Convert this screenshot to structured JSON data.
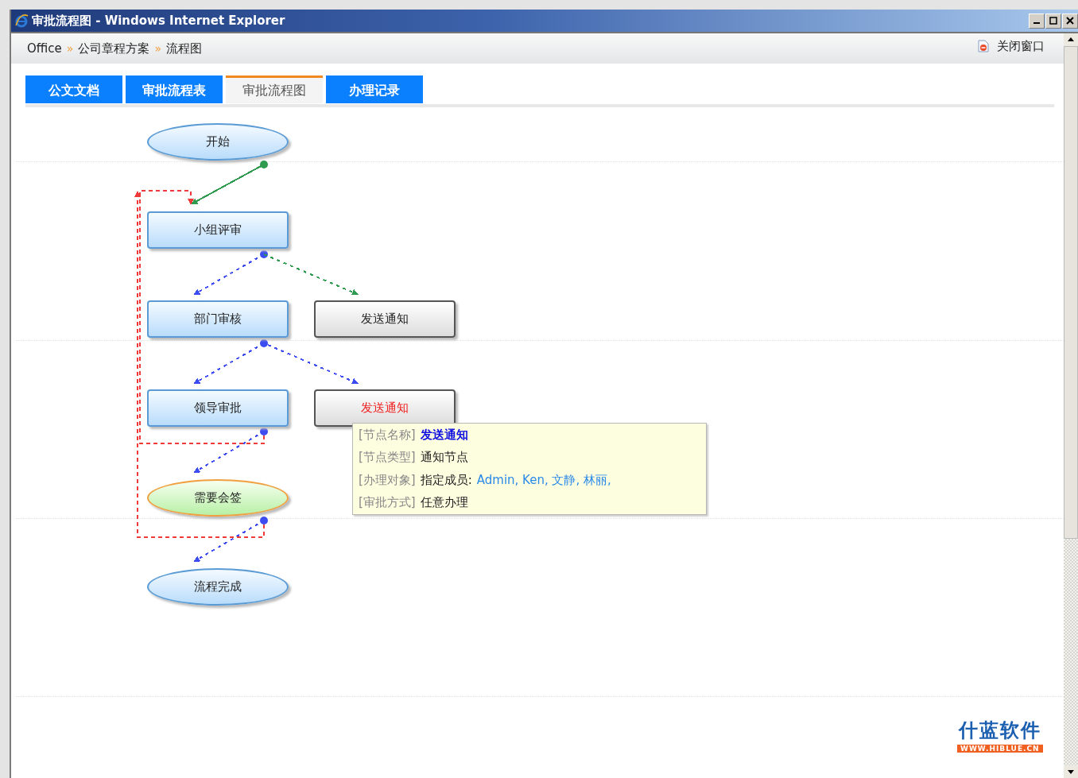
{
  "window": {
    "title": "审批流程图 - Windows Internet Explorer"
  },
  "breadcrumb": {
    "items": [
      "Office",
      "公司章程方案",
      "流程图"
    ],
    "separator": "»"
  },
  "close_link": "关闭窗口",
  "tabs": [
    {
      "label": "公文文档",
      "selected": false
    },
    {
      "label": "审批流程表",
      "selected": false
    },
    {
      "label": "审批流程图",
      "selected": true
    },
    {
      "label": "办理记录",
      "selected": false
    }
  ],
  "nodes": [
    {
      "label": "开始",
      "kind": "terminal",
      "highlighted": false
    },
    {
      "label": "小组评审",
      "kind": "task",
      "highlighted": false
    },
    {
      "label": "部门审核",
      "kind": "task",
      "highlighted": false
    },
    {
      "label": "发送通知",
      "kind": "notice",
      "highlighted": false
    },
    {
      "label": "领导审批",
      "kind": "task",
      "highlighted": false
    },
    {
      "label": "发送通知",
      "kind": "notice",
      "highlighted": true
    },
    {
      "label": "需要会签",
      "kind": "countersign",
      "highlighted": false
    },
    {
      "label": "流程完成",
      "kind": "terminal",
      "highlighted": false
    }
  ],
  "edges": [
    {
      "kind": "solid",
      "color": "#2e9b4e"
    },
    {
      "kind": "dashed",
      "color": "#3b4cf0"
    },
    {
      "kind": "dashed",
      "color": "#2e9b4e"
    },
    {
      "kind": "dashed",
      "color": "#3b4cf0"
    },
    {
      "kind": "dashed",
      "color": "#3b4cf0"
    },
    {
      "kind": "dashed",
      "color": "#3b4cf0"
    },
    {
      "kind": "return",
      "color": "#f03a3a"
    },
    {
      "kind": "dashed",
      "color": "#3b4cf0"
    },
    {
      "kind": "return",
      "color": "#f03a3a"
    }
  ],
  "tooltip": {
    "rows": [
      {
        "label": "[节点名称]",
        "kind": "name",
        "value": "发送通知"
      },
      {
        "label": "[节点类型]",
        "kind": "plain",
        "value": "通知节点"
      },
      {
        "label": "[办理对象]",
        "kind": "members",
        "value": "指定成员:",
        "members": "Admin, Ken, 文静, 林丽,"
      },
      {
        "label": "[审批方式]",
        "kind": "plain",
        "value": "任意办理"
      }
    ]
  },
  "logo": {
    "name": "什蓝软件",
    "url": "WWW.HIBLUE.CN"
  }
}
